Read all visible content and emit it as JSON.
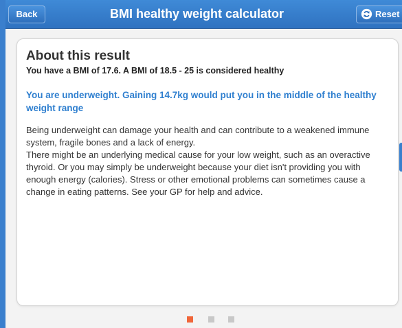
{
  "header": {
    "back_label": "Back",
    "title": "BMI healthy weight calculator",
    "reset_label": "Reset",
    "reset_icon": "refresh-icon"
  },
  "result": {
    "heading": "About this result",
    "summary": "You have a BMI of 17.6. A BMI of 18.5 - 25 is considered healthy",
    "verdict": "You are underweight. Gaining 14.7kg would put you in the middle of the healthy weight range",
    "paragraphs": [
      "Being underweight can damage your health and can contribute to a weakened immune system, fragile bones and a lack of energy.",
      "There might be an underlying medical cause for your low weight, such as an overactive thyroid. Or you may simply be underweight because your diet isn't providing you with enough energy (calories). Stress or other emotional problems can sometimes cause a change in eating patterns. See your GP for help and advice."
    ]
  },
  "pagination": {
    "total": 3,
    "current": 1
  },
  "colors": {
    "accent": "#3a7fcd",
    "verdict_text": "#2f7fcf",
    "active_dot": "#f0663a",
    "inactive_dot": "#c8c8c8"
  }
}
